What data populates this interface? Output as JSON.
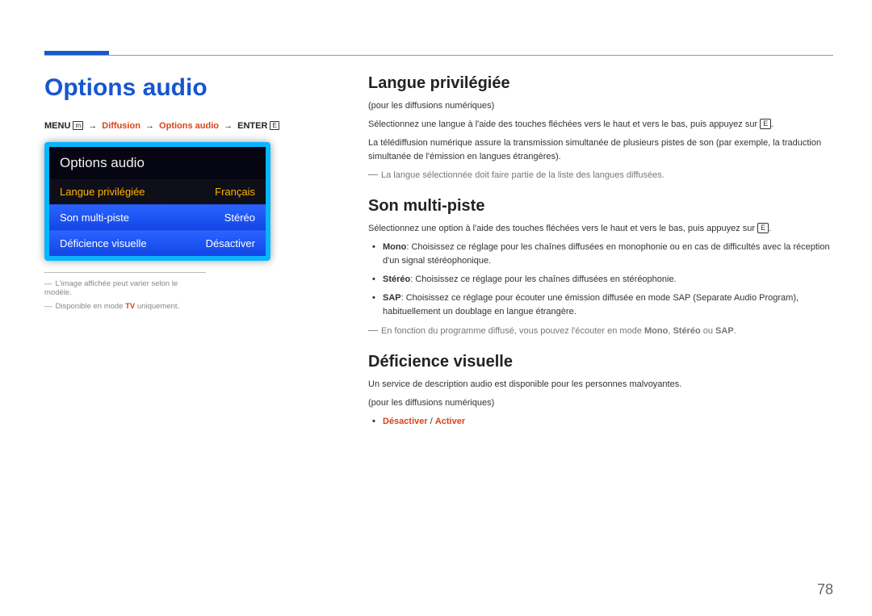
{
  "page_number": "78",
  "left": {
    "title": "Options audio",
    "breadcrumb": {
      "b1": "MENU",
      "iconMenu": "m",
      "arrow": "→",
      "b2": "Diffusion",
      "b3": "Options audio",
      "b4": "ENTER",
      "iconEnter": "E"
    },
    "osd": {
      "title": "Options audio",
      "rows": [
        {
          "label": "Langue privilégiée",
          "value": "Français",
          "selected": true
        },
        {
          "label": "Son multi-piste",
          "value": "Stéréo",
          "selected": false
        },
        {
          "label": "Déficience visuelle",
          "value": "Désactiver",
          "selected": false
        }
      ]
    },
    "foot1": "L'image affichée peut varier selon le modèle.",
    "foot2_a": "Disponible en mode ",
    "foot2_b": "TV",
    "foot2_c": " uniquement."
  },
  "sections": {
    "langue": {
      "heading": "Langue privilégiée",
      "p1": "(pour les diffusions numériques)",
      "p2a": "Sélectionnez une langue à l'aide des touches fléchées vers le haut et vers le bas, puis appuyez sur ",
      "p2b": ".",
      "p3": "La télédiffusion numérique assure la transmission simultanée de plusieurs pistes de son (par exemple, la traduction simultanée de l'émission en langues étrangères).",
      "note": "La langue sélectionnée doit faire partie de la liste des langues diffusées."
    },
    "son": {
      "heading": "Son multi-piste",
      "p1a": "Sélectionnez une option à l'aide des touches fléchées vers le haut et vers le bas, puis appuyez sur ",
      "p1b": ".",
      "b1_lbl": "Mono",
      "b1_txt": ": Choisissez ce réglage pour les chaînes diffusées en monophonie ou en cas de difficultés avec la réception d'un signal stéréophonique.",
      "b2_lbl": "Stéréo",
      "b2_txt": ": Choisissez ce réglage pour les chaînes diffusées en stéréophonie.",
      "b3_lbl": "SAP",
      "b3_txt": ": Choisissez ce réglage pour écouter une émission diffusée en mode SAP (Separate Audio Program), habituellement un doublage en langue étrangère.",
      "note_a": "En fonction du programme diffusé, vous pouvez l'écouter en mode ",
      "note_m": "Mono",
      "note_c1": ", ",
      "note_s": "Stéréo",
      "note_c2": " ou ",
      "note_sp": "SAP",
      "note_end": "."
    },
    "deficience": {
      "heading": "Déficience visuelle",
      "p1": "Un service de description audio est disponible pour les personnes malvoyantes.",
      "p2": "(pour les diffusions numériques)",
      "b1_a": "Désactiver",
      "b1_s": " / ",
      "b1_b": "Activer"
    }
  },
  "icons": {
    "enter": "E"
  }
}
